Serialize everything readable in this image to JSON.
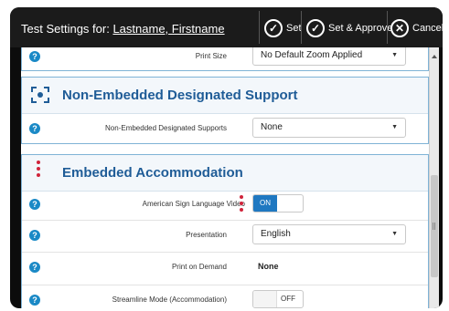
{
  "titlebar": {
    "title_prefix": "Test Settings for:",
    "student_name": "Lastname, Firstname",
    "buttons": {
      "set": "Set",
      "set_approve": "Set & Approve",
      "cancel": "Cancel"
    }
  },
  "top_row": {
    "label": "Print Size",
    "value": "No Default Zoom Applied"
  },
  "non_embedded": {
    "title": "Non-Embedded Designated Support",
    "rows": [
      {
        "label": "Non-Embedded Designated Supports",
        "value": "None"
      }
    ]
  },
  "embedded": {
    "title": "Embedded Accommodation",
    "rows": {
      "asl": {
        "label": "American Sign Language Video",
        "toggle": "ON"
      },
      "presentation": {
        "label": "Presentation",
        "value": "English"
      },
      "print_on_demand": {
        "label": "Print on Demand",
        "value": "None"
      },
      "streamline": {
        "label": "Streamline Mode (Accommodation)",
        "toggle": "OFF"
      }
    }
  },
  "colors": {
    "accent": "#1f78c1",
    "section_title": "#1f5c97",
    "required_marker": "#d0243b",
    "help_icon": "#1a89c6"
  }
}
